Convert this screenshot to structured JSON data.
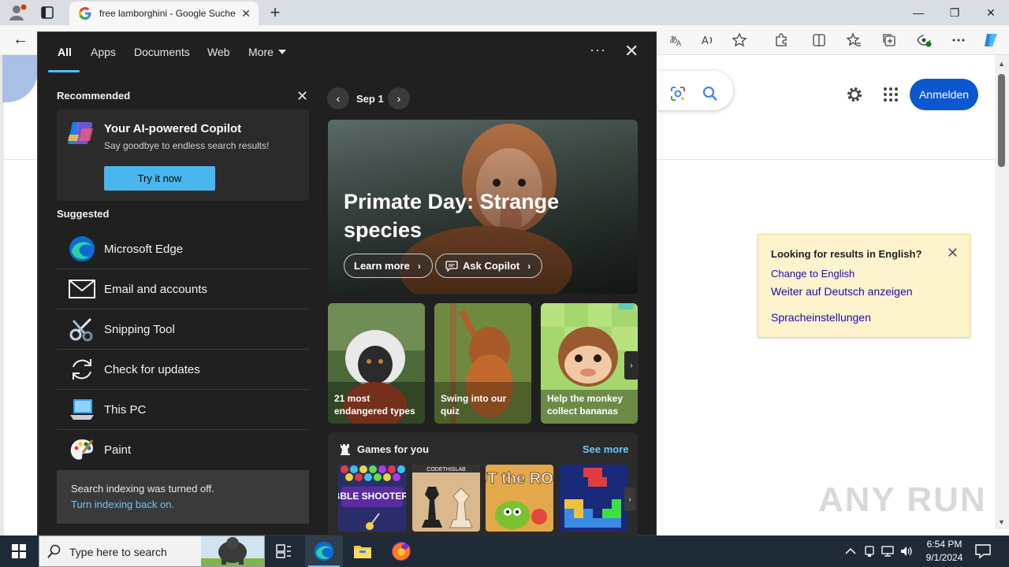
{
  "browser": {
    "tab_title": "free lamborghini - Google Suche",
    "tab_close": "✕",
    "new_tab": "+",
    "win_minimize": "—",
    "win_restore": "❐",
    "win_close": "✕",
    "back": "←"
  },
  "google": {
    "signin_label": "Anmelden",
    "lang_box": {
      "title": "Looking for results in English?",
      "close": "✕",
      "change_link": "Change to English",
      "stay_link": "Weiter auf Deutsch anzeigen",
      "settings_link": "Spracheinstellungen"
    },
    "watermark": "ANY RUN"
  },
  "search_panel": {
    "tabs": [
      {
        "label": "All",
        "active": true
      },
      {
        "label": "Apps",
        "active": false
      },
      {
        "label": "Documents",
        "active": false
      },
      {
        "label": "Web",
        "active": false
      },
      {
        "label": "More",
        "active": false
      }
    ],
    "options_label": "···",
    "close_label": "✕",
    "recommended_title": "Recommended",
    "recommended_close": "✕",
    "copilot_card": {
      "title": "Your AI-powered Copilot",
      "subtitle": "Say goodbye to endless search results!",
      "button": "Try it now"
    },
    "suggested_title": "Suggested",
    "suggested": [
      {
        "label": "Microsoft Edge",
        "icon": "edge-icon"
      },
      {
        "label": "Email and accounts",
        "icon": "mail-icon"
      },
      {
        "label": "Snipping Tool",
        "icon": "scissors-icon"
      },
      {
        "label": "Check for updates",
        "icon": "sync-icon"
      },
      {
        "label": "This PC",
        "icon": "computer-icon"
      },
      {
        "label": "Paint",
        "icon": "palette-icon"
      }
    ],
    "indexing": {
      "title": "Search indexing was turned off.",
      "link": "Turn indexing back on."
    },
    "date_prev": "‹",
    "date_next": "›",
    "date": "Sep 1",
    "hero": {
      "title": "Primate Day: Strange species",
      "learn_more": "Learn more",
      "ask_copilot": "Ask Copilot"
    },
    "cards": [
      {
        "caption": "21 most endangered types"
      },
      {
        "caption": "Swing into our quiz"
      },
      {
        "caption": "Help the monkey collect bananas"
      }
    ],
    "cards_next": "›",
    "games": {
      "title": "Games for you",
      "see_more": "See more",
      "items": [
        "Bubble Shooter HD",
        "Chess",
        "Cut the Rope",
        "Block puzzle"
      ],
      "tile_text": {
        "bubble": "BUBBLE SHOOTER HD",
        "chess": "CODETHISLAB",
        "cut": "CUT the ROPE"
      },
      "next": "›"
    }
  },
  "taskbar": {
    "search_placeholder": "Type here to search",
    "time": "6:54 PM",
    "date": "9/1/2024"
  },
  "colors": {
    "accent": "#4cc2ff",
    "google_blue": "#0b57d0",
    "panel_bg": "#202020",
    "taskbar_bg": "#1f2a37"
  }
}
